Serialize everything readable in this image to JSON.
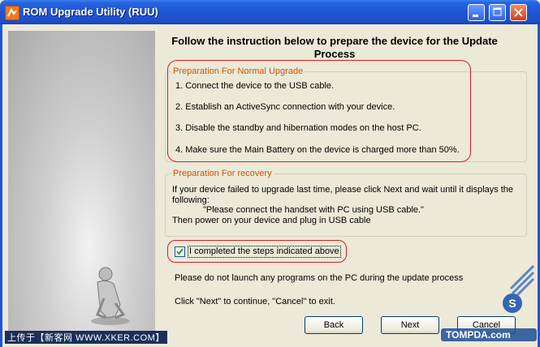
{
  "window": {
    "title": "ROM Upgrade Utility (RUU)",
    "colors": {
      "titlebar": "#1f55d3",
      "accent_orange": "#cc5500",
      "highlight_red": "#d51f1f"
    }
  },
  "header": {
    "line1": "Follow the instruction below to prepare the device for the Update",
    "line2": "Process"
  },
  "normal_upgrade": {
    "legend": "Preparation For Normal Upgrade",
    "steps": [
      "1. Connect the device to the USB cable.",
      "2. Establish an ActiveSync connection with your device.",
      "3. Disable the standby and hibernation modes on the host PC.",
      "4. Make sure the Main Battery on the device is charged more than 50%."
    ]
  },
  "recovery": {
    "legend": "Preparation For recovery",
    "line1": "If your device failed to upgrade last time, please click Next and wait until it displays the",
    "line2": "following:",
    "line3": "\"Please connect the handset with PC using USB cable.\"",
    "line4": "Then power on your device and plug in USB cable"
  },
  "confirm": {
    "label": "I completed the steps indicated above",
    "checked": true
  },
  "notes": {
    "warning": "Please do not launch any programs on the PC during the update process",
    "instruction": "Click \"Next\" to continue, \"Cancel\" to exit."
  },
  "buttons": {
    "back": "Back",
    "next": "Next",
    "cancel": "Cancel"
  },
  "watermarks": {
    "left": "上传于【新客网 WWW.XKER.COM】",
    "right": "TOMPDA.com"
  }
}
